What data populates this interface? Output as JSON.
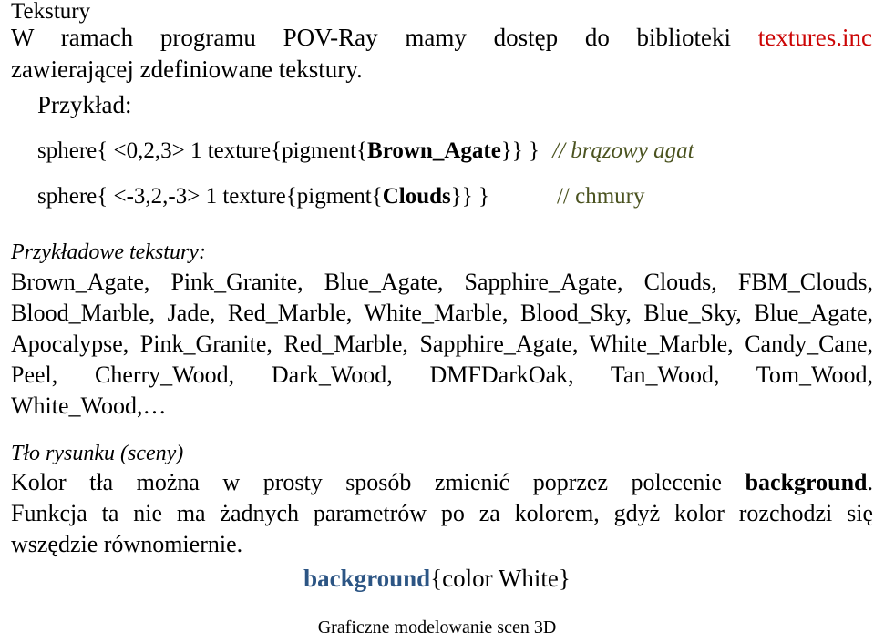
{
  "slide": {
    "title": "Tekstury",
    "intro": {
      "line1_pre": "W ramach programu POV-Ray mamy dostęp do biblioteki",
      "line1_file": "textures.inc",
      "line2": "zawierającej zdefiniowane tekstury."
    },
    "example_label": "Przykład:",
    "code_lines": [
      {
        "pre": "sphere{ <0,2,3>  1  texture{pigment{",
        "bold": "Brown_Agate",
        "post": "}} }",
        "comment": "// brązowy agat",
        "comment_style": "italic"
      },
      {
        "pre": "sphere{ <-3,2,-3>  1  texture{pigment{",
        "bold": "Clouds",
        "post": "}} }",
        "comment": "// chmury",
        "comment_style": "roman"
      }
    ],
    "textures_heading": "Przykładowe tekstury:",
    "textures_lines": [
      "Brown_Agate, Pink_Granite, Blue_Agate, Sapphire_Agate, Clouds, FBM_Clouds,",
      "Blood_Marble, Jade, Red_Marble, White_Marble, Blood_Sky, Blue_Sky, Blue_Agate,",
      "Apocalypse, Pink_Granite, Red_Marble, Sapphire_Agate, White_Marble, Candy_Cane,",
      "Peel, Cherry_Wood, Dark_Wood, DMFDarkOak, Tan_Wood, Tom_Wood,",
      "White_Wood,…"
    ],
    "background_heading": "Tło rysunku (sceny)",
    "background_par": {
      "line1_pre": "Kolor tła można w prosty sposób zmienić poprzez polecenie",
      "line1_bold": "background",
      "line1_post": ".",
      "line2": "Funkcja ta nie ma żadnych parametrów po za kolorem, gdyż kolor rozchodzi się",
      "line3": "wszędzie równomiernie."
    },
    "background_code": {
      "keyword": "background",
      "rest": "{color White}"
    },
    "footer": "Graficzne modelowanie scen 3D",
    "colors": {
      "file_red": "#cc0505",
      "comment_olive": "#4b5320",
      "keyword_blue": "#2c5584",
      "text_black": "#000000",
      "page_background": "#ffffff"
    }
  }
}
